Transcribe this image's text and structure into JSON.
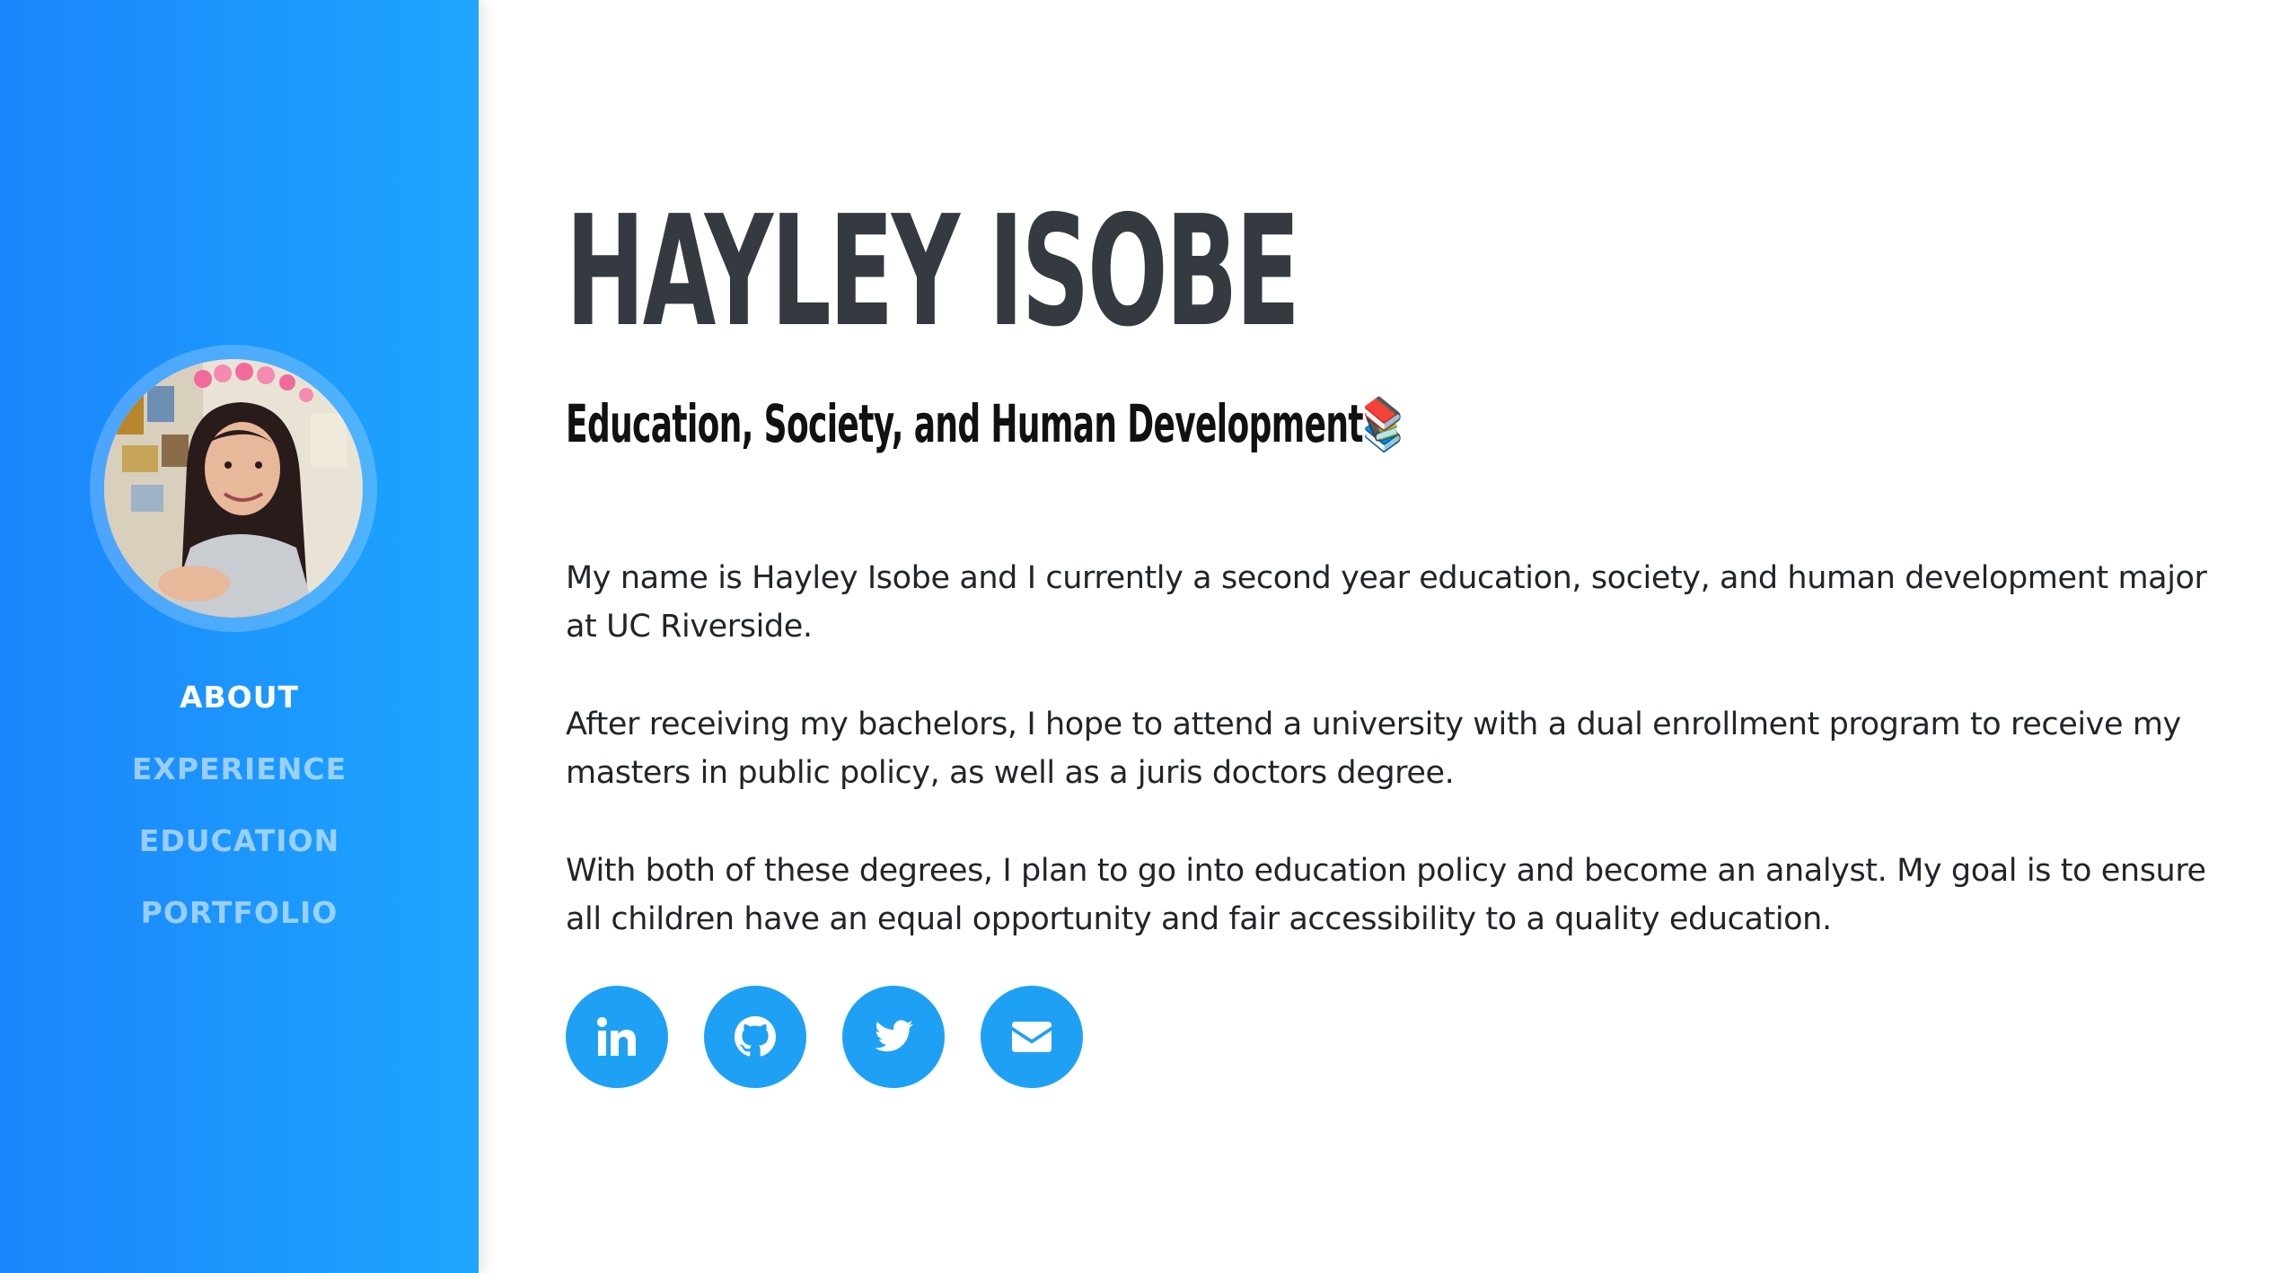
{
  "sidebar": {
    "nav": [
      {
        "label": "ABOUT",
        "active": true
      },
      {
        "label": "EXPERIENCE",
        "active": false
      },
      {
        "label": "EDUCATION",
        "active": false
      },
      {
        "label": "PORTFOLIO",
        "active": false
      }
    ],
    "gradient": [
      "#1a85fc",
      "#1ea6fd"
    ]
  },
  "header": {
    "name": "HAYLEY ISOBE",
    "subtitle": "Education, Society, and Human Development",
    "subtitle_emoji": "📚"
  },
  "about": {
    "paragraphs": [
      "My name is Hayley Isobe and I currently a second year education, society, and human development major at UC Riverside.",
      "After receiving my bachelors, I hope to attend a university with a dual enrollment program to receive my masters in public policy, as well as a juris doctors degree.",
      "With both of these degrees, I plan to go into education policy and become an analyst. My goal is to ensure all children have an equal opportunity and fair accessibility to a quality education."
    ]
  },
  "social": {
    "icons": [
      "linkedin-icon",
      "github-icon",
      "twitter-icon",
      "envelope-icon"
    ],
    "button_color": "#1ea1f4"
  },
  "colors": {
    "heading": "#343a40",
    "body_text": "#212529"
  }
}
